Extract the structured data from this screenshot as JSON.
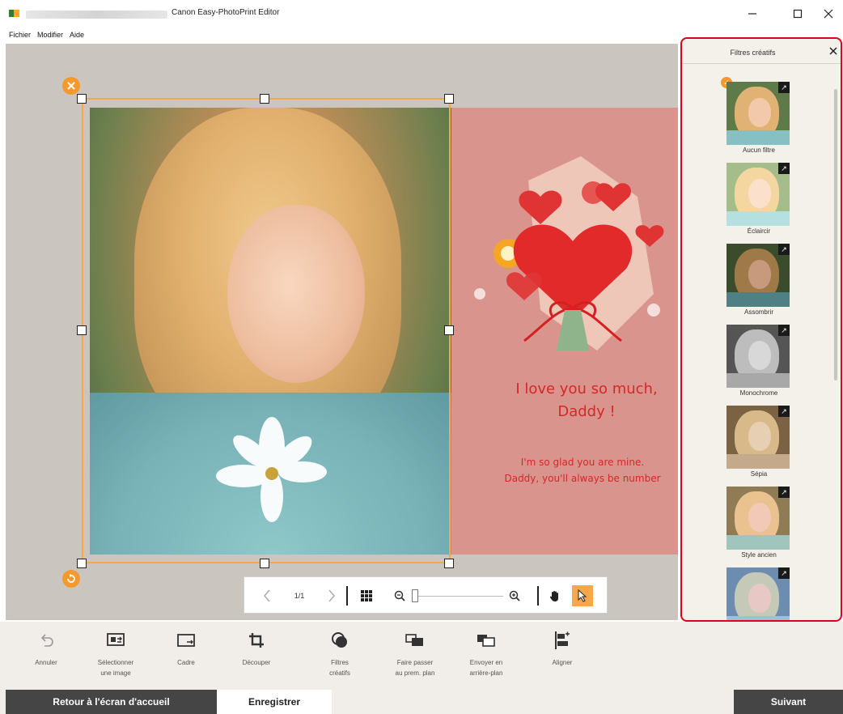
{
  "window": {
    "title": "Canon Easy-PhotoPrint Editor",
    "minimize_icon": "minimize-icon",
    "maximize_icon": "maximize-icon",
    "close_icon": "close-icon"
  },
  "menu": {
    "items": [
      "Fichier",
      "Modifier",
      "Aide"
    ]
  },
  "card": {
    "title_line1": "I love you so much,",
    "title_line2": "Daddy !",
    "subtitle_line1": "I'm so glad you are mine.",
    "subtitle_line2": "Daddy, you'll always be number"
  },
  "zoombar": {
    "page_indicator": "1/1"
  },
  "panel": {
    "title": "Filtres créatifs",
    "selected_filter": "Aucun filtre",
    "filters": [
      {
        "label": "Aucun filtre"
      },
      {
        "label": "Éclaircir"
      },
      {
        "label": "Assombrir"
      },
      {
        "label": "Monochrome"
      },
      {
        "label": "Sépia"
      },
      {
        "label": "Style ancien"
      },
      {
        "label": ""
      }
    ]
  },
  "toolbar": {
    "tools": [
      {
        "label_line1": "Annuler",
        "label_line2": "",
        "icon": "undo-icon"
      },
      {
        "label_line1": "Sélectionner",
        "label_line2": "une image",
        "icon": "select-image-icon"
      },
      {
        "label_line1": "Cadre",
        "label_line2": "",
        "icon": "frame-icon"
      },
      {
        "label_line1": "Découper",
        "label_line2": "",
        "icon": "crop-icon"
      },
      {
        "label_line1": "Filtres",
        "label_line2": "créatifs",
        "icon": "creative-filters-icon"
      },
      {
        "label_line1": "Faire passer",
        "label_line2": "au prem. plan",
        "icon": "bring-to-front-icon"
      },
      {
        "label_line1": "Envoyer en",
        "label_line2": "arrière-plan",
        "icon": "send-to-back-icon"
      },
      {
        "label_line1": "Aligner",
        "label_line2": "",
        "icon": "align-icon"
      }
    ]
  },
  "footer": {
    "back_label": "Retour à l'écran d'accueil",
    "save_label": "Enregistrer",
    "next_label": "Suivant"
  },
  "colors": {
    "accent": "#f7a64a",
    "highlight_border": "#e0001b",
    "card_background": "#d9958d",
    "card_text": "#d42828",
    "footer_dark": "#454545"
  }
}
